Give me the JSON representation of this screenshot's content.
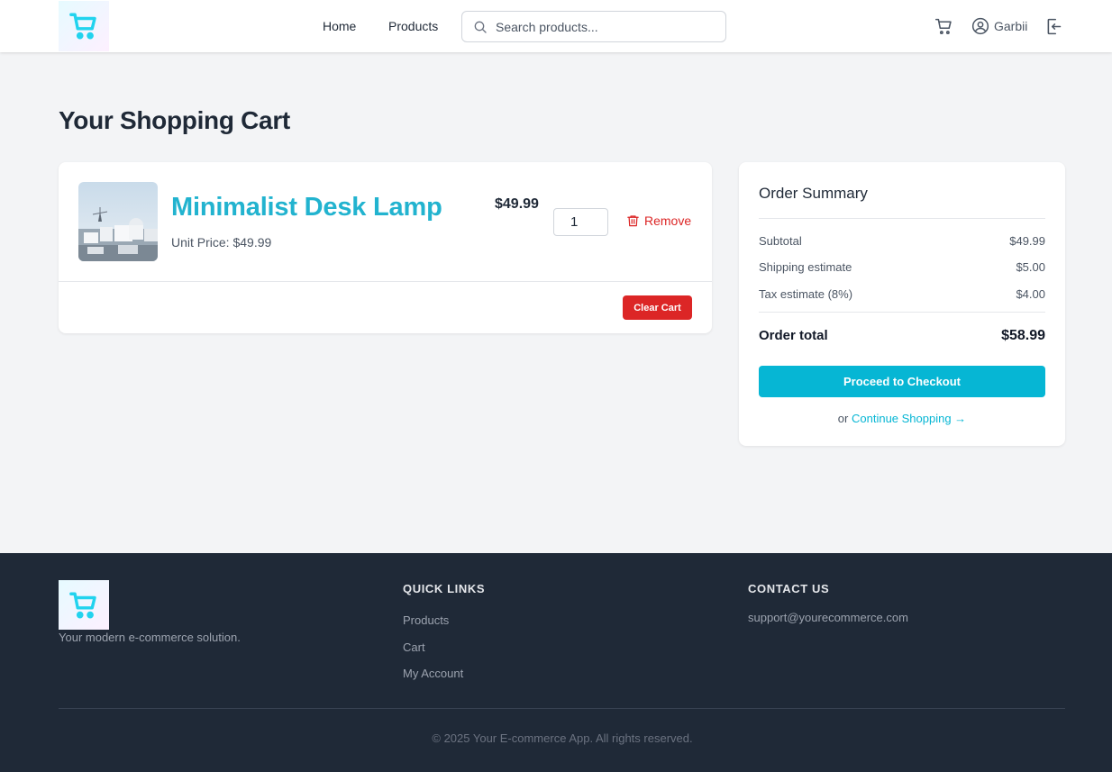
{
  "header": {
    "nav": [
      "Home",
      "Products"
    ],
    "search_placeholder": "Search products...",
    "user_name": "Garbii"
  },
  "page": {
    "title": "Your Shopping Cart"
  },
  "cart": {
    "items": [
      {
        "name": "Minimalist Desk Lamp",
        "unit_price": "Unit Price: $49.99",
        "price": "$49.99",
        "quantity": "1",
        "remove_label": "Remove"
      }
    ],
    "clear_label": "Clear Cart"
  },
  "summary": {
    "title": "Order Summary",
    "subtotal_label": "Subtotal",
    "subtotal": "$49.99",
    "shipping_label": "Shipping estimate",
    "shipping": "$5.00",
    "tax_label": "Tax estimate (8%)",
    "tax": "$4.00",
    "total_label": "Order total",
    "total": "$58.99",
    "checkout_label": "Proceed to Checkout",
    "or_text": "or",
    "continue_label": "Continue Shopping →"
  },
  "footer": {
    "tagline": "Your modern e-commerce solution.",
    "quick_links_title": "QUICK LINKS",
    "quick_links": [
      "Products",
      "Cart",
      "My Account"
    ],
    "contact_title": "CONTACT US",
    "email": "support@yourecommerce.com",
    "copyright": "© 2025 Your E-commerce App. All rights reserved."
  },
  "colors": {
    "accent": "#06b6d4",
    "danger": "#dc2626",
    "footer_bg": "#1f2937",
    "page_bg": "#f3f4f6"
  }
}
